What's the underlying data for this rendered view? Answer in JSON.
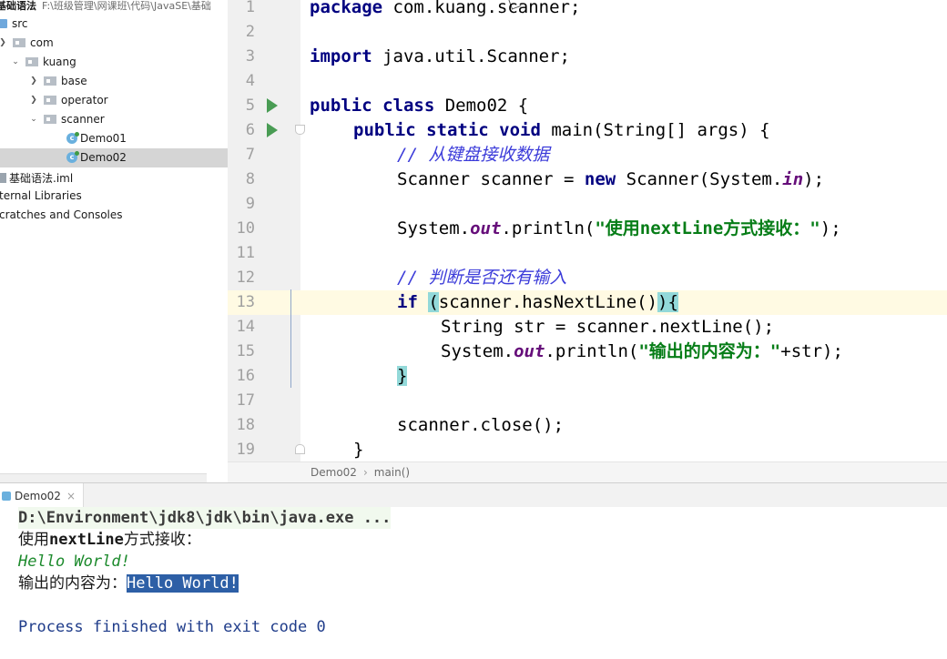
{
  "project": {
    "root_name": "基础语法",
    "root_path": "F:\\班级管理\\网课班\\代码\\JavaSE\\基础",
    "items": [
      {
        "label": "src",
        "icon": "src-folder-icon"
      },
      {
        "label": "com",
        "icon": "package-icon"
      },
      {
        "label": "kuang",
        "icon": "package-icon"
      },
      {
        "label": "base",
        "icon": "package-icon"
      },
      {
        "label": "operator",
        "icon": "package-icon"
      },
      {
        "label": "scanner",
        "icon": "package-icon"
      },
      {
        "label": "Demo01",
        "icon": "java-class-icon"
      },
      {
        "label": "Demo02",
        "icon": "java-class-icon"
      },
      {
        "label": "基础语法.iml",
        "icon": "iml-file-icon"
      },
      {
        "label": "ternal Libraries",
        "icon": ""
      },
      {
        "label": "cratches and Consoles",
        "icon": ""
      }
    ],
    "selected": "Demo02"
  },
  "editor": {
    "line_numbers": [
      "1",
      "2",
      "3",
      "4",
      "5",
      "6",
      "7",
      "8",
      "9",
      "10",
      "11",
      "12",
      "13",
      "14",
      "15",
      "16",
      "17",
      "18",
      "19"
    ],
    "current_line": "13",
    "code": {
      "l1_kw": "package",
      "l1_rest": " com.kuang.scanner;",
      "l3_kw": "import",
      "l3_rest": " java.util.Scanner;",
      "l5_kw": "public class",
      "l5_rest": " Demo02 {",
      "l6_kw": "public static void",
      "l6_rest": " main(String[] args) {",
      "l7_cmt": "// 从键盘接收数据",
      "l8_a": "Scanner scanner = ",
      "l8_kw": "new",
      "l8_b": " Scanner(System.",
      "l8_stat": "in",
      "l8_c": ");",
      "l10_a": "System.",
      "l10_stat": "out",
      "l10_b": ".println(",
      "l10_str": "\"使用nextLine方式接收：\"",
      "l10_c": ");",
      "l12_cmt": "// 判断是否还有输入",
      "l13_kw": "if",
      "l13_sp": " ",
      "l13_paren": "(",
      "l13_a": "scanner.hasNextLine()",
      "l13_paren2": ")",
      "l13_brace": "{",
      "l14": "String str = scanner.nextLine();",
      "l15_a": "System.",
      "l15_stat": "out",
      "l15_b": ".println(",
      "l15_str": "\"输出的内容为：\"",
      "l15_c": "+str);",
      "l16_brace": "}",
      "l18": "scanner.close();",
      "l19": "}"
    }
  },
  "breadcrumb": {
    "items": [
      "Demo02",
      "main()"
    ]
  },
  "run_panel": {
    "tab_label": "Demo02",
    "console": {
      "command": "D:\\Environment\\jdk8\\jdk\\bin\\java.exe ...",
      "prompt_prefix": "使用",
      "prompt_bold": "nextLine",
      "prompt_suffix": "方式接收：",
      "user_input": "Hello World!",
      "output_prefix": "输出的内容为：",
      "output_value": "Hello World!",
      "finish": "Process finished with exit code 0"
    }
  },
  "colors": {
    "keyword": "#000080",
    "string": "#067d17",
    "comment": "#3b3bd9",
    "run_icon": "#499c54",
    "current_line": "#fffae3",
    "selection": "#2d5fa6"
  }
}
